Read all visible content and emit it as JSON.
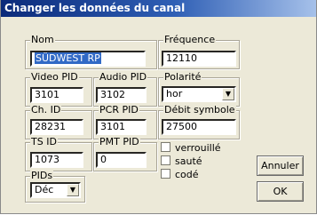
{
  "window": {
    "title": "Changer les données du canal"
  },
  "fields": {
    "nom": {
      "label": "Nom",
      "value": "SÜDWEST RP"
    },
    "frequence": {
      "label": "Fréquence",
      "value": "12110"
    },
    "video_pid": {
      "label": "Video PID",
      "value": "3101"
    },
    "audio_pid": {
      "label": "Audio PID",
      "value": "3102"
    },
    "polarite": {
      "label": "Polarité",
      "value": "hor"
    },
    "ch_id": {
      "label": "Ch. ID",
      "value": "28231"
    },
    "pcr_pid": {
      "label": "PCR PID",
      "value": "3101"
    },
    "debit_symbole": {
      "label": "Débit symbole",
      "value": "27500"
    },
    "ts_id": {
      "label": "TS ID",
      "value": "1073"
    },
    "pmt_pid": {
      "label": "PMT PID",
      "value": "0"
    },
    "pids": {
      "label": "PIDs",
      "value": "Déc"
    }
  },
  "checkboxes": {
    "verrouille": {
      "label": "verrouillé",
      "checked": false
    },
    "saute": {
      "label": "sauté",
      "checked": false
    },
    "code": {
      "label": "codé",
      "checked": false
    }
  },
  "buttons": {
    "cancel": "Annuler",
    "ok": "OK"
  }
}
